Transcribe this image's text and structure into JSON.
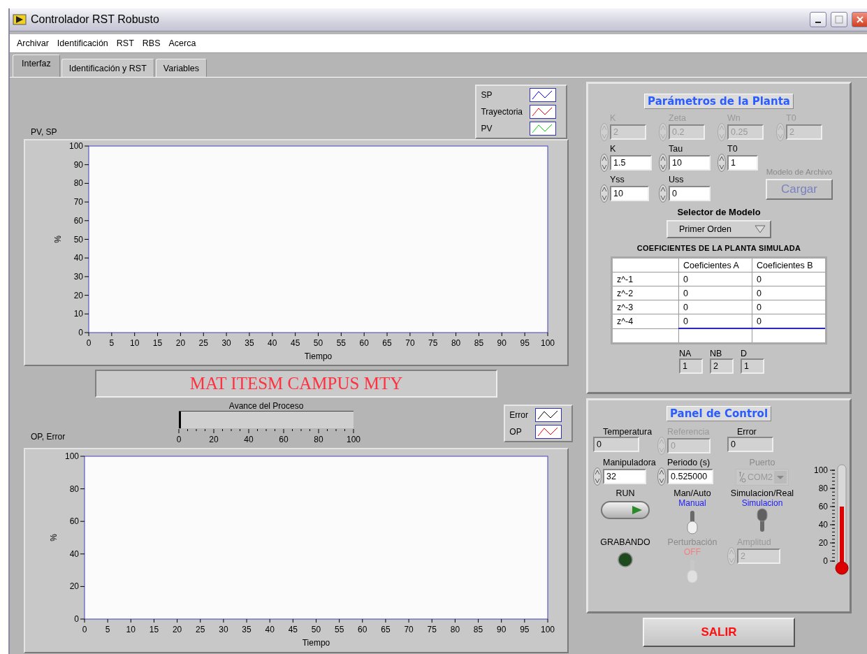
{
  "window": {
    "title": "Controlador RST Robusto"
  },
  "menu": [
    "Archivar",
    "Identificación",
    "RST",
    "RBS",
    "Acerca"
  ],
  "tabs": [
    {
      "label": "Interfaz",
      "selected": true
    },
    {
      "label": "Identificación y RST",
      "selected": false
    },
    {
      "label": "Variables",
      "selected": false
    }
  ],
  "process_chart": {
    "legend": [
      {
        "label": "SP",
        "color": "#0000ff"
      },
      {
        "label": "Trayectoria",
        "color": "#ff0000"
      },
      {
        "label": "PV",
        "color": "#00dd00"
      }
    ],
    "chart_data": {
      "type": "line",
      "title": "PV, SP",
      "xlabel": "Tiempo",
      "ylabel": "%",
      "xlim": [
        0,
        100
      ],
      "ylim": [
        0,
        100
      ],
      "xticks": [
        0,
        5,
        10,
        15,
        20,
        25,
        30,
        35,
        40,
        45,
        50,
        55,
        60,
        65,
        70,
        75,
        80,
        85,
        90,
        95,
        100
      ],
      "yticks": [
        0,
        10,
        20,
        30,
        40,
        50,
        60,
        70,
        80,
        90,
        100
      ]
    }
  },
  "banner": "MAT ITESM CAMPUS MTY",
  "progress": {
    "label": "Avance del Proceso",
    "level": 0.01,
    "ticks": [
      "0",
      "20",
      "40",
      "60",
      "80",
      "100"
    ]
  },
  "output_chart": {
    "legend": [
      {
        "label": "Error",
        "color": "#000000"
      },
      {
        "label": "OP",
        "color": "#ff0000"
      }
    ],
    "chart_data": {
      "type": "line",
      "title": "OP, Error",
      "xlabel": "Tiempo",
      "ylabel": "%",
      "xlim": [
        0,
        100
      ],
      "ylim": [
        0,
        100
      ],
      "xticks": [
        0,
        5,
        10,
        15,
        20,
        25,
        30,
        35,
        40,
        45,
        50,
        55,
        60,
        65,
        70,
        75,
        80,
        85,
        90,
        95,
        100
      ],
      "yticks": [
        0,
        20,
        40,
        60,
        80,
        100
      ]
    }
  },
  "plant_panel": {
    "title": "Parámetros de la Planta",
    "rows": [
      [
        {
          "label": "K",
          "value": "2",
          "disabled": true
        },
        {
          "label": "Zeta",
          "value": "0.2",
          "disabled": true
        },
        {
          "label": "Wn",
          "value": "0.25",
          "disabled": true
        },
        {
          "label": "T0",
          "value": "2",
          "disabled": true
        }
      ],
      [
        {
          "label": "K",
          "value": "1.5",
          "disabled": false
        },
        {
          "label": "Tau",
          "value": "10",
          "disabled": false
        },
        {
          "label": "T0",
          "value": "1",
          "disabled": false
        }
      ],
      [
        {
          "label": "Yss",
          "value": "10",
          "disabled": false
        },
        {
          "label": "Uss",
          "value": "0",
          "disabled": false
        }
      ]
    ],
    "file_model": {
      "label": "Modelo de Archivo",
      "button": "Cargar",
      "disabled": true
    },
    "model_selector": {
      "label": "Selector de Modelo",
      "value": "Primer Orden"
    },
    "coefficients": {
      "title": "COEFICIENTES DE LA PLANTA SIMULADA",
      "columns": [
        "Coeficientes A",
        "Coeficientes B"
      ],
      "rows": [
        {
          "label": "z^-1",
          "values": [
            "0",
            "0"
          ]
        },
        {
          "label": "z^-2",
          "values": [
            "0",
            "0"
          ]
        },
        {
          "label": "z^-3",
          "values": [
            "0",
            "0"
          ]
        },
        {
          "label": "z^-4",
          "values": [
            "0",
            "0"
          ]
        }
      ]
    },
    "orders": [
      {
        "label": "NA",
        "value": "1"
      },
      {
        "label": "NB",
        "value": "2"
      },
      {
        "label": "D",
        "value": "1"
      }
    ]
  },
  "control_panel": {
    "title": "Panel de Control",
    "items": [
      {
        "kind": "indicator",
        "label": "Temperatura",
        "value": "0",
        "disabled": false
      },
      {
        "kind": "spinner",
        "label": "Referencia",
        "value": "0",
        "disabled": true
      },
      {
        "kind": "indicator",
        "label": "Error",
        "value": "0",
        "disabled": false
      },
      {
        "kind": "spinner",
        "label": "Manipuladora",
        "value": "32",
        "disabled": false
      },
      {
        "kind": "spinner",
        "label": "Periodo (s)",
        "value": "0.525000",
        "disabled": false
      },
      {
        "kind": "dropdown",
        "label": "Puerto",
        "value": "COM2",
        "disabled": true
      },
      {
        "kind": "button",
        "label": "RUN",
        "disabled": false
      },
      {
        "kind": "toggle",
        "label": "Man/Auto",
        "state_text": "Manual",
        "on": false,
        "disabled": false
      },
      {
        "kind": "toggle",
        "label": "Simulacion/Real",
        "state_text": "Simulacion",
        "on": true,
        "disabled": false
      },
      {
        "kind": "led",
        "label": "GRABANDO",
        "on": false,
        "disabled": false
      },
      {
        "kind": "toggle",
        "label": "Perturbación",
        "state_text": "OFF",
        "on": false,
        "disabled": true
      },
      {
        "kind": "spinner",
        "label": "Amplitud",
        "value": "2",
        "disabled": true
      }
    ],
    "thermometer": {
      "level": 0.6,
      "ticks": [
        "100",
        "80",
        "60",
        "40",
        "20",
        "0"
      ]
    }
  },
  "exit_button": "SALIR"
}
